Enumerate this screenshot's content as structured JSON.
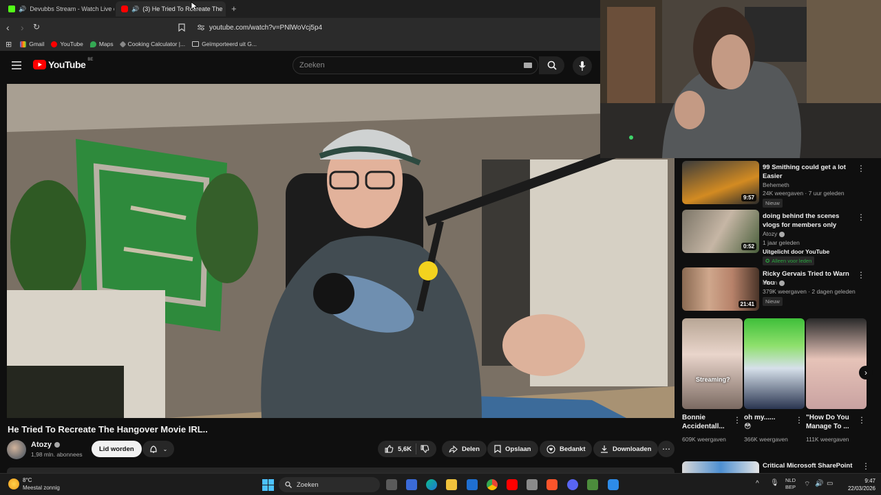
{
  "browser": {
    "tabs": [
      {
        "label": "Devubbs Stream - Watch Live on",
        "active": false
      },
      {
        "label": "(3) He Tried To Recreate The",
        "active": true
      }
    ],
    "new_tab": "+",
    "url": "youtube.com/watch?v=PNlWoVcj5p4",
    "bookmarks": [
      "Gmail",
      "YouTube",
      "Maps",
      "Cooking Calculator |...",
      "Geïmporteerd uit G..."
    ]
  },
  "youtube": {
    "logo_text": "YouTube",
    "region": "BE",
    "search_placeholder": "Zoeken"
  },
  "video": {
    "title": "He Tried To Recreate The Hangover Movie IRL..",
    "channel": "Atozy",
    "subscribers": "1,98 mln. abonnees",
    "join_label": "Lid worden",
    "likes": "5,6K",
    "share_label": "Delen",
    "save_label": "Opslaan",
    "thanks_label": "Bedankt",
    "download_label": "Downloaden"
  },
  "recommendations": [
    {
      "title": "99 Smithing could get a lot Easier",
      "channel": "Behemeth",
      "meta": "24K weergaven · 7 uur geleden",
      "badge": "Nieuw",
      "duration": "9:57"
    },
    {
      "title": "doing behind the scenes vlogs for members only",
      "channel": "Atozy",
      "meta": "1 jaar geleden",
      "extra": "Uitgelicht door YouTube",
      "badge": "Alleen voor leden",
      "duration": "0:52"
    },
    {
      "title": "Ricky Gervais Tried to Warn You",
      "channel": "Moon",
      "meta": "379K weergaven · 2 dagen geleden",
      "badge": "Nieuw",
      "duration": "21:41"
    }
  ],
  "shorts": [
    {
      "title": "Bonnie Accidentall...",
      "views": "609K weergaven",
      "overlay": "Streaming?"
    },
    {
      "title": "oh my......",
      "views": "366K weergaven",
      "emoji": "😳"
    },
    {
      "title": "\"How Do You Manage To ...",
      "views": "111K weergaven"
    }
  ],
  "next_rec_title": "Critical Microsoft SharePoint",
  "taskbar": {
    "weather_temp": "8°C",
    "weather_text": "Meestal zonnig",
    "search_label": "Zoeken",
    "lang_top": "NLD",
    "lang_bottom": "BEP",
    "time": "9:47",
    "date": "22/03/2026"
  },
  "colors": {
    "accent_red": "#ff0000",
    "bg": "#0f0f0f",
    "pill": "#272727",
    "member_green": "#2ba640"
  }
}
